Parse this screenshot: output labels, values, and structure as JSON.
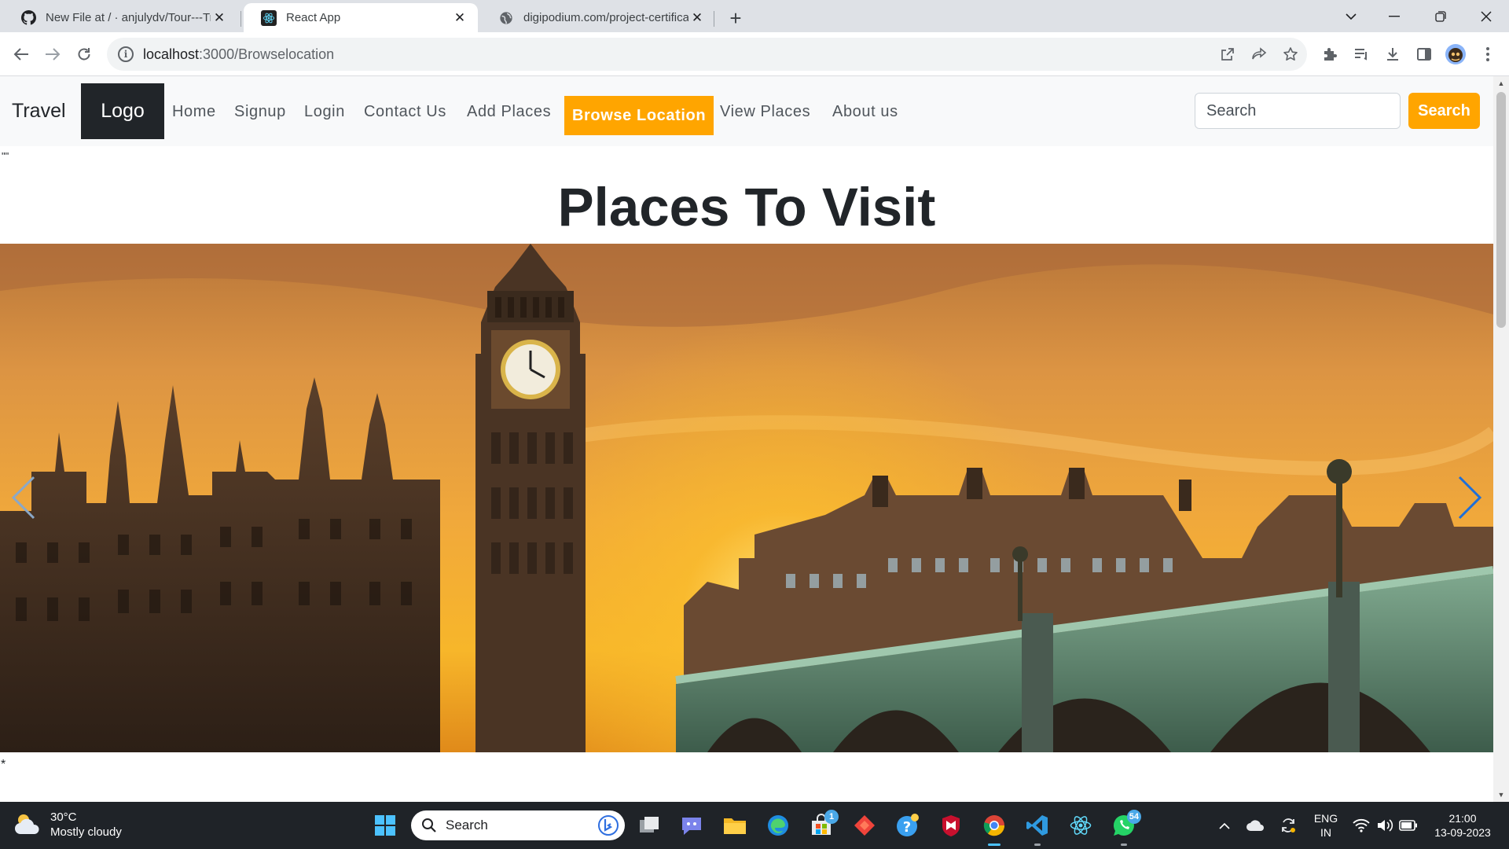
{
  "browser": {
    "tabs": [
      {
        "title": "New File at / · anjulydv/Tour---Travel",
        "icon": "github-icon"
      },
      {
        "title": "React App",
        "icon": "react-icon"
      },
      {
        "title": "digipodium.com/project-certificate",
        "icon": "globe-icon"
      }
    ],
    "active_tab": 1,
    "url_host": "localhost",
    "url_path": ":3000/Browselocation"
  },
  "navbar": {
    "brand": "Travel",
    "logo": "Logo",
    "links": [
      "Home",
      "Signup",
      "Login",
      "Contact Us",
      "Add Places",
      "Browse Location",
      "View Places",
      "About us"
    ],
    "active_link": "Browse Location",
    "search_placeholder": "Search",
    "search_button": "Search",
    "accent_color": "#ffa500"
  },
  "page": {
    "stray_top": "\"\"",
    "title": "Places To Visit",
    "stray_bottom": "*"
  },
  "taskbar": {
    "weather_temp": "30°C",
    "weather_desc": "Mostly cloudy",
    "search_placeholder": "Search",
    "store_badge": "1",
    "whatsapp_badge": "54",
    "lang_top": "ENG",
    "lang_bottom": "IN",
    "time": "21:00",
    "date": "13-09-2023"
  }
}
